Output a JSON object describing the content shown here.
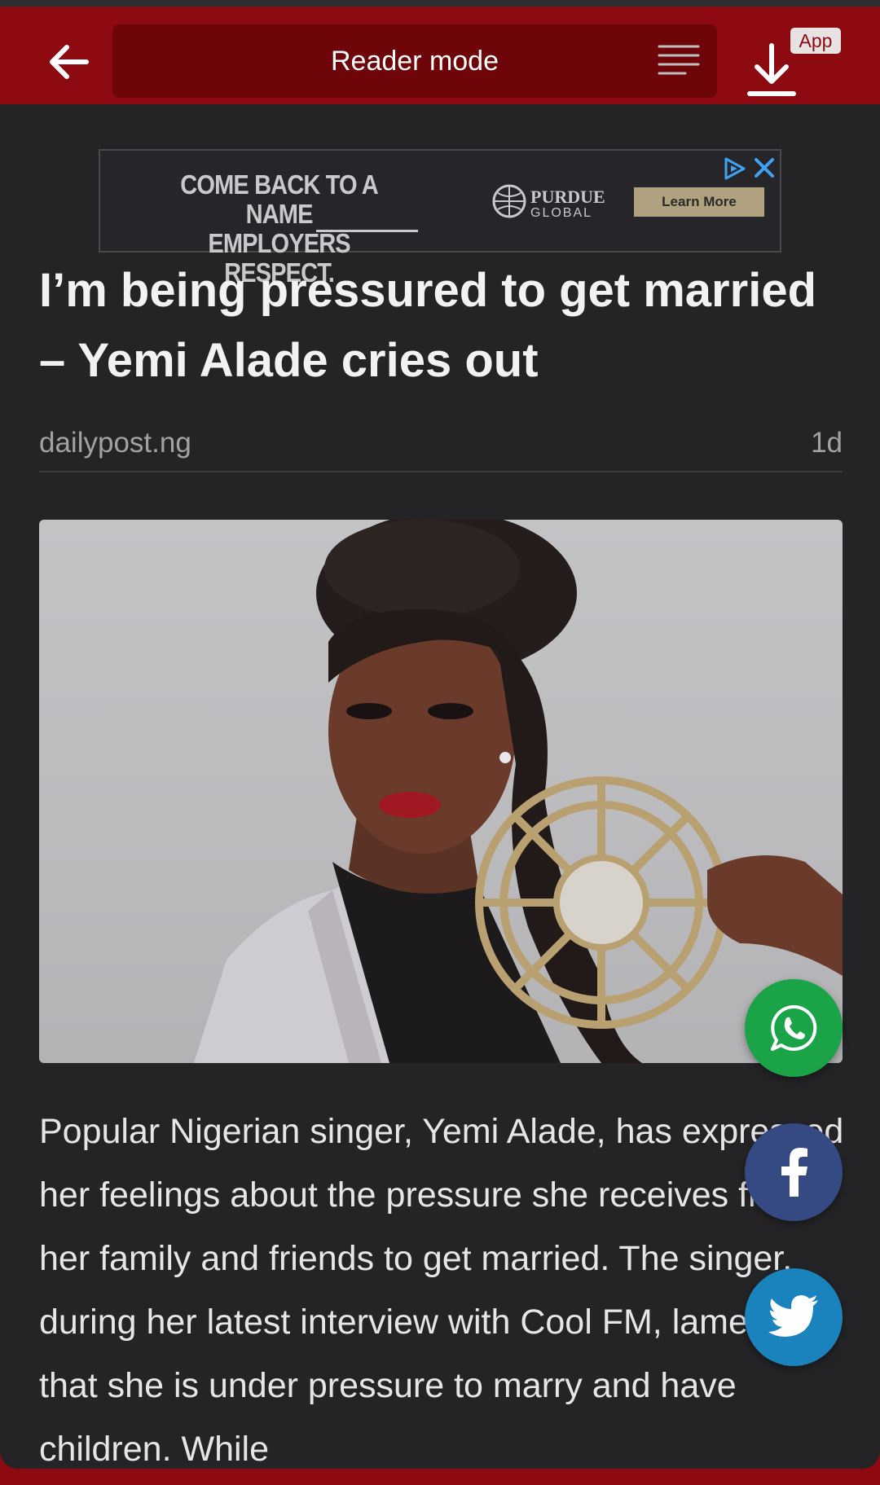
{
  "toolbar": {
    "title": "Reader mode",
    "app_badge": "App"
  },
  "ad": {
    "headline_line1": "COME BACK TO A NAME",
    "headline_line2": "EMPLOYERS RESPECT.",
    "brand_line1": "PURDUE",
    "brand_line2": "GLOBAL",
    "cta": "Learn More"
  },
  "article": {
    "title": "I’m being pressured to get married – Yemi Alade cries out",
    "source": "dailypost.ng",
    "age": "1d",
    "body": "Popular Nigerian singer, Yemi Alade, has expressed her feelings about the pressure she receives from her family and friends to get married. The singer, during her latest interview with Cool FM, lamented that she is under pressure to marry and have children. While"
  },
  "share": [
    "whatsapp",
    "facebook",
    "twitter"
  ],
  "colors": {
    "brand_red": "#8c0a10",
    "background": "#242426",
    "whatsapp": "#1aa447",
    "facebook": "#354a82",
    "twitter": "#1a82bd"
  }
}
